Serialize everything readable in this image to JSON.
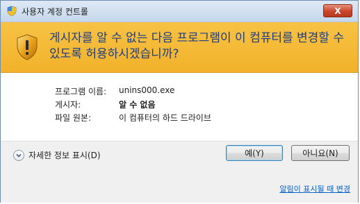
{
  "window": {
    "title": "사용자 계정 컨트롤",
    "close_label": "X"
  },
  "banner": {
    "question": "게시자를 알 수 없는 다음 프로그램이 이 컴퓨터를 변경할 수 있도록 허용하시겠습니까?"
  },
  "details": {
    "program_name_label": "프로그램 이름:",
    "program_name_value": "unins000.exe",
    "publisher_label": "게시자:",
    "publisher_value": "알 수 없음",
    "origin_label": "파일 원본:",
    "origin_value": "이 컴퓨터의 하드 드라이브"
  },
  "footer": {
    "show_details_label": "자세한 정보 표시(D)",
    "yes_label": "예(Y)",
    "no_label": "아니요(N)",
    "notification_link": "알림이 표시될 때 변경"
  },
  "colors": {
    "banner": "#f2b22a",
    "banner_text": "#1a3d8a",
    "link": "#0b62c4",
    "close_button": "#c9452b"
  },
  "icons": {
    "title": "uac-shield-icon",
    "banner": "warning-shield-icon",
    "details_toggle": "chevron-down-icon"
  }
}
